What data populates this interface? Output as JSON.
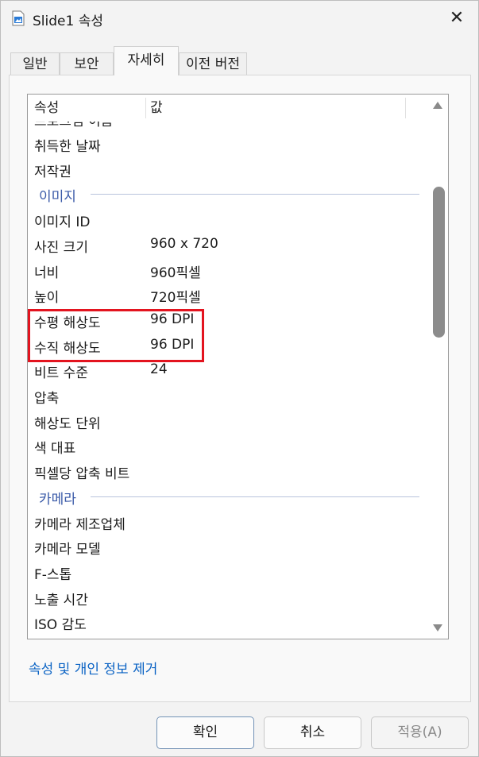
{
  "window": {
    "title": "Slide1 속성",
    "close_glyph": "✕"
  },
  "tabs": [
    {
      "label": "일반"
    },
    {
      "label": "보안"
    },
    {
      "label": "자세히"
    },
    {
      "label": "이전 버전"
    }
  ],
  "list": {
    "columns": {
      "property": "속성",
      "value": "값"
    },
    "cut_top_text": "프로그램 이름",
    "rows": [
      {
        "type": "row",
        "property": "취득한 날짜",
        "value": ""
      },
      {
        "type": "row",
        "property": "저작권",
        "value": ""
      },
      {
        "type": "group",
        "label": "이미지"
      },
      {
        "type": "row",
        "property": "이미지 ID",
        "value": ""
      },
      {
        "type": "row",
        "property": "사진 크기",
        "value": "960 x 720"
      },
      {
        "type": "row",
        "property": "너비",
        "value": "960픽셀"
      },
      {
        "type": "row",
        "property": "높이",
        "value": "720픽셀"
      },
      {
        "type": "row",
        "property": "수평 해상도",
        "value": "96 DPI"
      },
      {
        "type": "row",
        "property": "수직 해상도",
        "value": "96 DPI"
      },
      {
        "type": "row",
        "property": "비트 수준",
        "value": "24"
      },
      {
        "type": "row",
        "property": "압축",
        "value": ""
      },
      {
        "type": "row",
        "property": "해상도 단위",
        "value": ""
      },
      {
        "type": "row",
        "property": "색 대표",
        "value": ""
      },
      {
        "type": "row",
        "property": "픽셀당 압축 비트",
        "value": ""
      },
      {
        "type": "group",
        "label": "카메라"
      },
      {
        "type": "row",
        "property": "카메라 제조업체",
        "value": ""
      },
      {
        "type": "row",
        "property": "카메라 모델",
        "value": ""
      },
      {
        "type": "row",
        "property": "F-스톱",
        "value": ""
      },
      {
        "type": "row",
        "property": "노출 시간",
        "value": ""
      },
      {
        "type": "row",
        "property": "ISO 감도",
        "value": ""
      }
    ]
  },
  "remove_link": "속성 및 개인 정보 제거",
  "buttons": {
    "ok": "확인",
    "cancel": "취소",
    "apply": "적용(A)"
  },
  "colors": {
    "highlight": "#e3141f",
    "link": "#0b63c4",
    "group": "#3a5aa8"
  }
}
